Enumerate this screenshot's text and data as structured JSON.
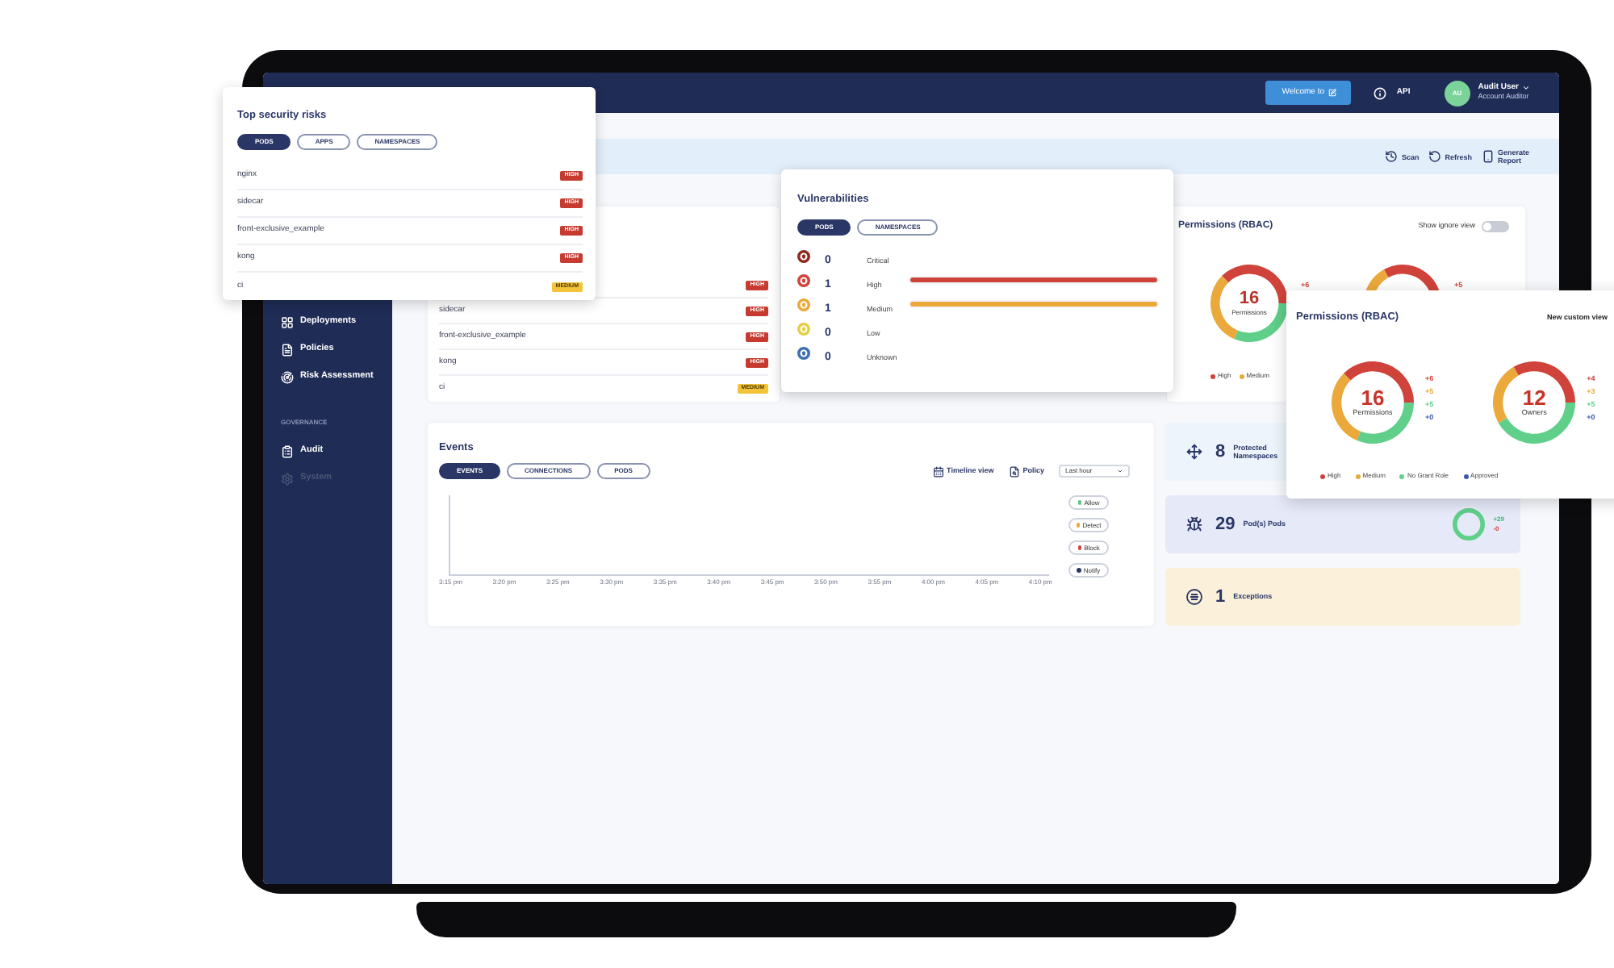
{
  "top_bar": {
    "welcome_button": {
      "label": "Welcome to"
    },
    "api_link": {
      "label": "API"
    },
    "user": {
      "initials": "AU",
      "name": "Audit User",
      "role": "Account Auditor"
    }
  },
  "sidebar": {
    "sections": [
      {
        "items": [
          {
            "label": "Deployments",
            "disabled": false
          },
          {
            "label": "Policies",
            "disabled": false
          },
          {
            "label": "Risk Assessment",
            "disabled": false
          }
        ]
      },
      {
        "heading": "GOVERNANCE",
        "items": [
          {
            "label": "Audit",
            "disabled": false
          },
          {
            "label": "System",
            "disabled": true
          }
        ]
      }
    ]
  },
  "header_actions": [
    {
      "label": "Scan"
    },
    {
      "label": "Refresh"
    },
    {
      "label": "Generate Report"
    }
  ],
  "risks_card": {
    "rows": [
      {
        "severity": "HIGH",
        "kind": "high"
      },
      {
        "name": "sidecar",
        "severity": "HIGH",
        "kind": "high"
      },
      {
        "name": "front-exclusive_example",
        "severity": "HIGH",
        "kind": "high"
      },
      {
        "name": "kong",
        "severity": "HIGH",
        "kind": "high"
      },
      {
        "name": "ci",
        "severity": "MEDIUM",
        "kind": "medium"
      }
    ]
  },
  "permissions_card": {
    "title": "Permissions (RBAC)",
    "toggle": {
      "label": "Show ignore view",
      "on": false
    },
    "donuts": [
      {
        "total": "16",
        "label": "Permissions",
        "breakdown": [
          "+6"
        ],
        "chart_data": {
          "type": "donut",
          "values": [
            37.5,
            31.25,
            31.25,
            0
          ]
        }
      },
      {
        "breakdown": [
          "+5"
        ]
      }
    ],
    "legend": [
      {
        "label": "High",
        "color": "#d0433a"
      },
      {
        "label": "Medium",
        "color": "#eaa93a"
      }
    ]
  },
  "events_card": {
    "title": "Events",
    "tabs": [
      {
        "label": "EVENTS",
        "selected": true
      },
      {
        "label": "CONNECTIONS",
        "selected": false
      },
      {
        "label": "PODS",
        "selected": false
      }
    ],
    "timeline_view": {
      "label": "Timeline view"
    },
    "policy_filter": {
      "label": "Policy"
    },
    "range_select": {
      "value": "Last hour"
    },
    "x_labels": [
      "3:15 pm",
      "3:20 pm",
      "3:25 pm",
      "3:30 pm",
      "3:35 pm",
      "3:40 pm",
      "3:45 pm",
      "3:50 pm",
      "3:55 pm",
      "4:00 pm",
      "4:05 pm",
      "4:10 pm"
    ],
    "legend": [
      {
        "label": "Allow",
        "color": "#5cc485"
      },
      {
        "label": "Detect",
        "color": "#f0a63a"
      },
      {
        "label": "Block",
        "color": "#d0433a"
      },
      {
        "label": "Notify",
        "color": "#2a3766"
      }
    ]
  },
  "summary_tiles": [
    {
      "count": "8",
      "label": "Protected Namespaces",
      "color": "#edf4fb"
    },
    {
      "count": "29",
      "label": "Pod(s) Pods",
      "color": "#e6e9f8",
      "changes": [
        {
          "text": "+29",
          "kind": "increase"
        },
        {
          "text": "-0",
          "kind": "decrease"
        }
      ]
    },
    {
      "count": "1",
      "label": "Exceptions",
      "color": "#fbf0da"
    }
  ],
  "top_risks_popup": {
    "title": "Top security risks",
    "tabs": [
      {
        "label": "PODS",
        "selected": true
      },
      {
        "label": "APPS",
        "selected": false
      },
      {
        "label": "NAMESPACES",
        "selected": false
      }
    ],
    "rows": [
      {
        "name": "nginx",
        "severity": "HIGH",
        "kind": "high"
      },
      {
        "name": "sidecar",
        "severity": "HIGH",
        "kind": "high"
      },
      {
        "name": "front-exclusive_example",
        "severity": "HIGH",
        "kind": "high"
      },
      {
        "name": "kong",
        "severity": "HIGH",
        "kind": "high"
      },
      {
        "name": "ci",
        "severity": "MEDIUM",
        "kind": "medium"
      }
    ]
  },
  "vulnerabilities_popup": {
    "title": "Vulnerabilities",
    "tabs": [
      {
        "label": "PODS",
        "selected": true
      },
      {
        "label": "NAMESPACES",
        "selected": false
      }
    ],
    "rows": [
      {
        "count": "0",
        "label": "Critical",
        "color": "#8e2b1e"
      },
      {
        "count": "1",
        "label": "High",
        "color": "#d0433a",
        "level": 1
      },
      {
        "count": "1",
        "label": "Medium",
        "color": "#eaa93a",
        "level": 1
      },
      {
        "count": "0",
        "label": "Low",
        "color": "#e6cf45"
      },
      {
        "count": "0",
        "label": "Unknown",
        "color": "#3f6fae"
      }
    ]
  },
  "permissions_popup": {
    "title": "Permissions (RBAC)",
    "action": "New custom view",
    "donuts": [
      {
        "total": "16",
        "label": "Permissions",
        "breakdown": [
          "+6",
          "+5",
          "+5",
          "+0"
        ],
        "chart_data": {
          "type": "donut",
          "values": [
            37.5,
            31.25,
            31.25,
            0
          ]
        }
      },
      {
        "total": "12",
        "label": "Owners",
        "breakdown": [
          "+4",
          "+3",
          "+5",
          "+0"
        ],
        "chart_data": {
          "type": "donut",
          "values": [
            33.3,
            25,
            41.7,
            0
          ]
        }
      }
    ],
    "legend": [
      {
        "label": "High",
        "color": "#d0433a"
      },
      {
        "label": "Medium",
        "color": "#eaa93a"
      },
      {
        "label": "No Grant Role",
        "color": "#5fcf8a"
      },
      {
        "label": "Approved",
        "color": "#3c5aa6"
      }
    ]
  }
}
